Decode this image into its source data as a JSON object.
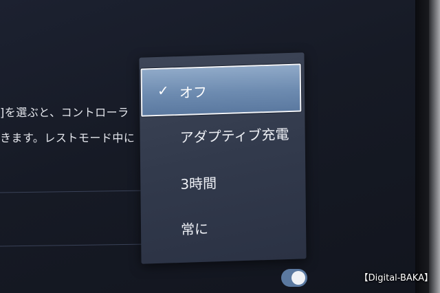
{
  "description": {
    "line1": "]を選ぶと、コントローラ",
    "line2": "きます。レストモード中に"
  },
  "dropdown": {
    "selected_index": 0,
    "options": [
      {
        "label": "オフ",
        "checked": true
      },
      {
        "label": "アダプティブ充電",
        "checked": false
      },
      {
        "label": "3時間",
        "checked": false
      },
      {
        "label": "常に",
        "checked": false
      }
    ],
    "check_glyph": "✓"
  },
  "toggle": {
    "on": true
  },
  "watermark": "【Digital-BAKA】",
  "colors": {
    "selected_bg": "#7a96bb",
    "menu_bg": "#353d4f",
    "screen_bg": "#161a25"
  }
}
